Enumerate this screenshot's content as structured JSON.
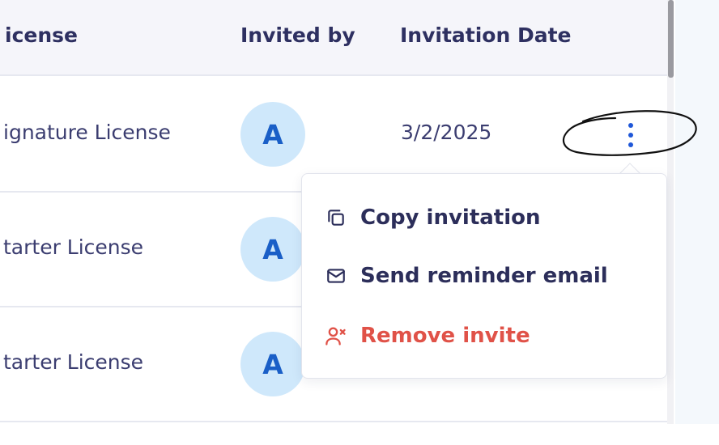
{
  "table": {
    "headers": {
      "license": "icense",
      "invited_by": "Invited by",
      "invitation_date": "Invitation Date"
    },
    "rows": [
      {
        "license": "ignature License",
        "avatar": "A",
        "date": "3/2/2025"
      },
      {
        "license": "tarter License",
        "avatar": "A",
        "date": ""
      },
      {
        "license": "tarter License",
        "avatar": "A",
        "date": ""
      }
    ]
  },
  "row_actions": {
    "icon": "more-vertical-icon"
  },
  "context_menu": {
    "items": [
      {
        "label": "Copy invitation",
        "icon": "copy-icon"
      },
      {
        "label": "Send reminder email",
        "icon": "mail-icon"
      },
      {
        "label": "Remove invite",
        "icon": "user-remove-icon",
        "color": "#e05248"
      }
    ]
  },
  "colors": {
    "accent": "#1f57d8",
    "avatar_bg": "#cfe8fb",
    "danger": "#e05248",
    "text": "#2c2e5a"
  }
}
